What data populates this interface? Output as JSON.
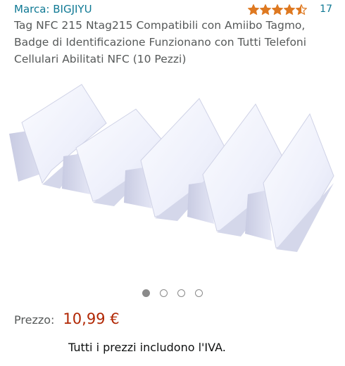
{
  "header": {
    "brand_label": "Marca: BIGJIYU",
    "rating": {
      "stars": 4.5,
      "max": 5,
      "star_color": "#de7921",
      "review_count": "17"
    }
  },
  "product": {
    "title": "Tag NFC 215 Ntag215 Compatibili con Amiibo Tagmo, Badge di Identificazione Funzionano con Tutti Telefoni Cellulari Abilitati NFC (10 Pezzi)"
  },
  "carousel": {
    "total_images": 4,
    "active_index": 0
  },
  "price": {
    "label": "Prezzo:",
    "value": "10,99 €",
    "vat_note": "Tutti i prezzi includono l'IVA."
  },
  "colors": {
    "link": "#0f7994",
    "price": "#b12704",
    "muted_text": "#565959"
  }
}
